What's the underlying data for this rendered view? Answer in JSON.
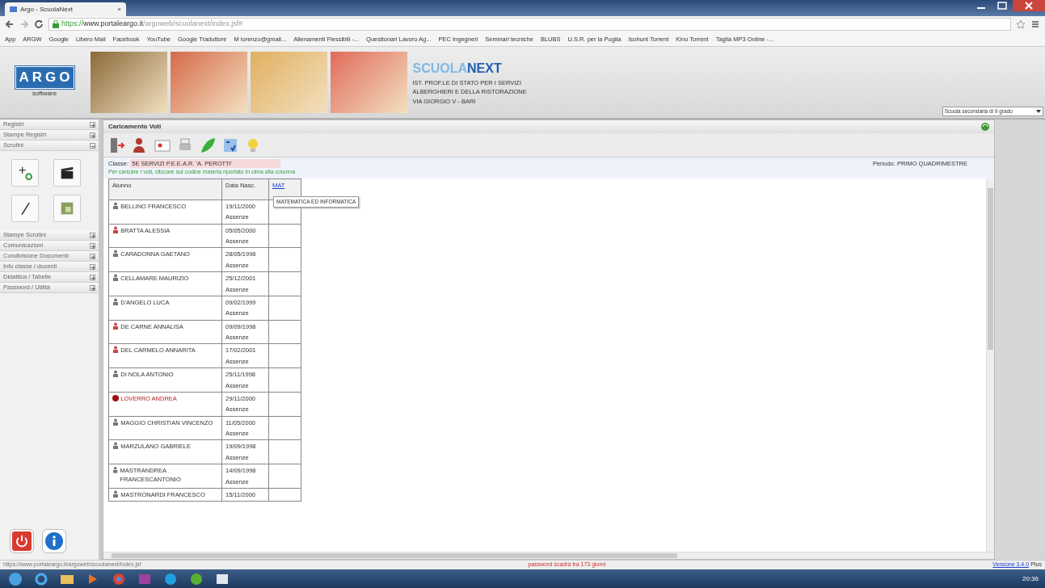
{
  "browser": {
    "tab_title": "Argo - ScuolaNext",
    "tab_close": "×",
    "url_scheme": "https://",
    "url_host": "www.portaleargo.it",
    "url_path": "/argoweb/scuolanext/index.jsf#",
    "bookmarks": [
      "App",
      "ARGW",
      "Google",
      "Libero Mail",
      "Facebook",
      "YouTube",
      "Google Traduttore",
      "M lorenzo@gmail...",
      "Allenamenti Flessibili -...",
      "Questionari Lavoro Ag...",
      "PEC Ingegneri",
      "Seminari tecniche",
      "BLUBS",
      "U.S.R. per la Puglia",
      "Isohunt Torrent",
      "Kino Torrent",
      "Taglia MP3 Online -..."
    ]
  },
  "header": {
    "logo": "ARGO",
    "logo_sub": "software",
    "product_a": "SCUOLA",
    "product_b": "NEXT",
    "school_lines": [
      "IST. PROF.LE DI STATO PER I SERVIZI",
      "ALBERGHIERI E DELLA RISTORAZIONE",
      "VIA GIORGIO V - BARI"
    ],
    "school_select": "Scuola secondaria di II grado"
  },
  "sidebar": {
    "sections": [
      {
        "label": "Registri",
        "expanded": false
      },
      {
        "label": "Stampe Registri",
        "expanded": false
      },
      {
        "label": "Scrutini",
        "expanded": true
      },
      {
        "label": "Stampe Scrutini",
        "expanded": false
      },
      {
        "label": "Comunicazioni",
        "expanded": false
      },
      {
        "label": "Condivisione Documenti",
        "expanded": false
      },
      {
        "label": "Info classe / docenti",
        "expanded": false
      },
      {
        "label": "Didattica / Tabelle",
        "expanded": false
      },
      {
        "label": "Password / Utilità",
        "expanded": false
      }
    ]
  },
  "panel": {
    "title": "Caricamento Voti",
    "class_label": "Classe:",
    "class_value": "5E SERVIZI P.E.E.A.R. 'A. PEROTTI'",
    "hint": "Per caricare i voti, cliccare sul codice materia riportato in cima alla colonna",
    "period": "Periodo: PRIMO QUADRIMESTRE",
    "table": {
      "columns": [
        "Alunno",
        "Data Nasc.",
        "MAT"
      ],
      "tooltip": "MATEMATICA ED INFORMATICA",
      "rows": [
        {
          "name": "BELLINO FRANCESCO",
          "birth": "19/11/2000",
          "absences": "Assenze",
          "kind": "male"
        },
        {
          "name": "BRATTA ALESSIA",
          "birth": "05/05/2000",
          "absences": "Assenze",
          "kind": "female"
        },
        {
          "name": "CARADONNA GAETANO",
          "birth": "28/05/1998",
          "absences": "Assenze",
          "kind": "male"
        },
        {
          "name": "CELLAMARE MAURIZIO",
          "birth": "25/12/2001",
          "absences": "Assenze",
          "kind": "male"
        },
        {
          "name": "D'ANGELO LUCA",
          "birth": "09/02/1999",
          "absences": "Assenze",
          "kind": "male"
        },
        {
          "name": "DE CARNE ANNALISA",
          "birth": "09/09/1998",
          "absences": "Assenze",
          "kind": "female"
        },
        {
          "name": "DEL CARMELO ANNARITA",
          "birth": "17/02/2001",
          "absences": "Assenze",
          "kind": "female"
        },
        {
          "name": "DI NOLA ANTONIO",
          "birth": "25/11/1998",
          "absences": "Assenze",
          "kind": "male"
        },
        {
          "name": "LOVERRO ANDREA",
          "birth": "29/11/2000",
          "absences": "Assenze",
          "kind": "alert"
        },
        {
          "name": "MAGGIO CHRISTIAN VINCENZO",
          "birth": "11/05/2000",
          "absences": "Assenze",
          "kind": "male"
        },
        {
          "name": "MARZULANO GABRIELE",
          "birth": "19/09/1998",
          "absences": "Assenze",
          "kind": "male"
        },
        {
          "name": "MASTRANDREA FRANCESCANTONIO",
          "birth": "14/09/1998",
          "absences": "Assenze",
          "kind": "male"
        },
        {
          "name": "MASTRONARDI FRANCESCO",
          "birth": "15/11/2000",
          "kind": "male"
        }
      ]
    }
  },
  "status_bar": {
    "link_url": "https://www.portaleargo.it/argoweb/scuolanext/index.jsf",
    "message": "password scadrà tra 173 giorni",
    "version": "Versione 3.4.0",
    "version_suffix": "Plus"
  },
  "taskbar": {
    "clock": "20:36"
  }
}
